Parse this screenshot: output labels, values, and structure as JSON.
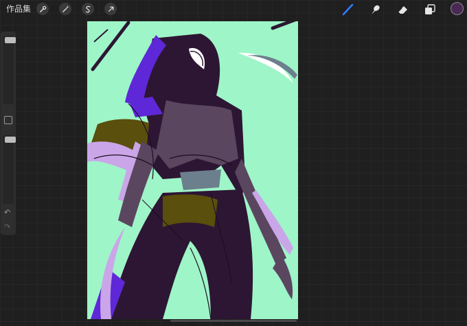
{
  "toolbar": {
    "gallery_label": "作品集",
    "actions_icon": "wrench-icon",
    "adjustments_icon": "magic-wand-icon",
    "selection_icon": "selection-s-icon",
    "transform_icon": "arrow-cursor-icon",
    "brush_icon": "brush-icon",
    "smudge_icon": "smudge-finger-icon",
    "eraser_icon": "eraser-icon",
    "layers_icon": "layers-icon",
    "color_swatch": "#4a2a55"
  },
  "sidebar": {
    "brush_size": 0.98,
    "opacity": 0.98,
    "undo_icon": "undo-icon",
    "redo_icon": "redo-icon"
  },
  "canvas": {
    "colors": {
      "background": "#9ef5c8",
      "figure_dark": "#2d1633",
      "figure_mid": "#5b4660",
      "purple": "#5e28d8",
      "lilac": "#caa6e8",
      "olive": "#5a4f0c",
      "grey_blue": "#6c7f8c",
      "white": "#ffffff"
    }
  }
}
